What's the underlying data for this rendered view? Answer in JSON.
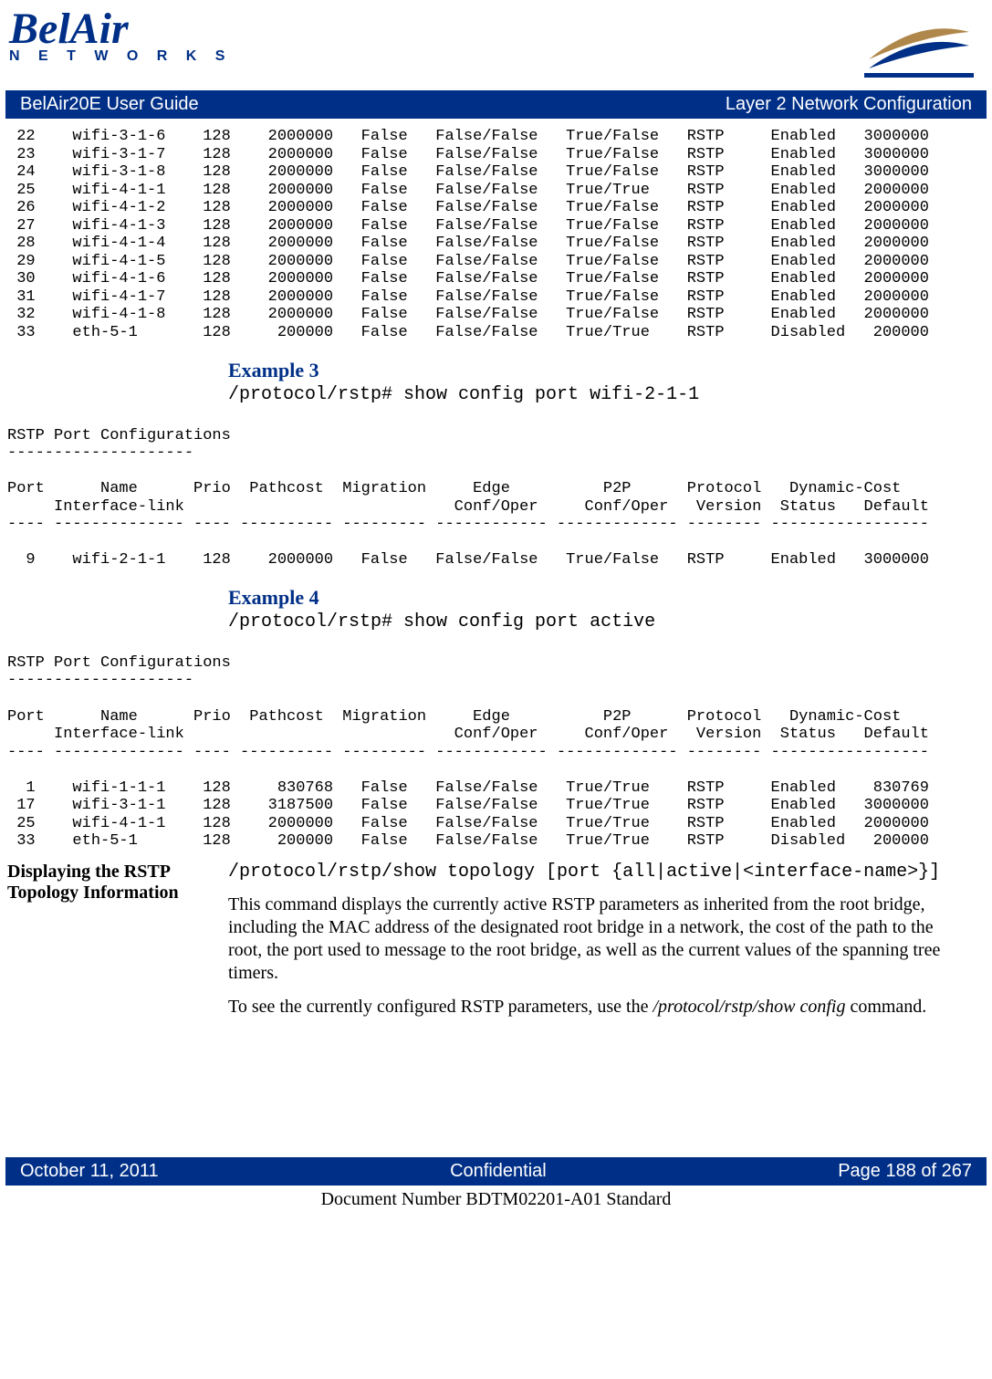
{
  "logo": {
    "brand": "BelAir",
    "sub": "N E T W O R K S"
  },
  "titlebar": {
    "left": "BelAir20E User Guide",
    "right": "Layer 2 Network Configuration"
  },
  "table1": " 22    wifi-3-1-6    128    2000000   False   False/False   True/False   RSTP     Enabled   3000000\n 23    wifi-3-1-7    128    2000000   False   False/False   True/False   RSTP     Enabled   3000000\n 24    wifi-3-1-8    128    2000000   False   False/False   True/False   RSTP     Enabled   3000000\n 25    wifi-4-1-1    128    2000000   False   False/False   True/True    RSTP     Enabled   2000000\n 26    wifi-4-1-2    128    2000000   False   False/False   True/False   RSTP     Enabled   2000000\n 27    wifi-4-1-3    128    2000000   False   False/False   True/False   RSTP     Enabled   2000000\n 28    wifi-4-1-4    128    2000000   False   False/False   True/False   RSTP     Enabled   2000000\n 29    wifi-4-1-5    128    2000000   False   False/False   True/False   RSTP     Enabled   2000000\n 30    wifi-4-1-6    128    2000000   False   False/False   True/False   RSTP     Enabled   2000000\n 31    wifi-4-1-7    128    2000000   False   False/False   True/False   RSTP     Enabled   2000000\n 32    wifi-4-1-8    128    2000000   False   False/False   True/False   RSTP     Enabled   2000000\n 33    eth-5-1       128     200000   False   False/False   True/True    RSTP     Disabled   200000",
  "ex3": {
    "heading": "Example 3",
    "cmd": "/protocol/rstp# show config port wifi-2-1-1"
  },
  "table2": "RSTP Port Configurations\n--------------------\n\nPort      Name      Prio  Pathcost  Migration     Edge          P2P      Protocol   Dynamic-Cost\n     Interface-link                             Conf/Oper     Conf/Oper   Version  Status   Default\n---- -------------- ---- ---------- --------- ------------ ------------- -------- -----------------\n\n  9    wifi-2-1-1    128    2000000   False   False/False   True/False   RSTP     Enabled   3000000",
  "ex4": {
    "heading": "Example 4",
    "cmd": "/protocol/rstp# show config port active"
  },
  "table3": "RSTP Port Configurations\n--------------------\n\nPort      Name      Prio  Pathcost  Migration     Edge          P2P      Protocol   Dynamic-Cost\n     Interface-link                             Conf/Oper     Conf/Oper   Version  Status   Default\n---- -------------- ---- ---------- --------- ------------ ------------- -------- -----------------\n\n  1    wifi-1-1-1    128     830768   False   False/False   True/True    RSTP     Enabled    830769\n 17    wifi-3-1-1    128    3187500   False   False/False   True/True    RSTP     Enabled   3000000\n 25    wifi-4-1-1    128    2000000   False   False/False   True/True    RSTP     Enabled   2000000\n 33    eth-5-1       128     200000   False   False/False   True/True    RSTP     Disabled   200000",
  "section": {
    "title": "Displaying the RSTP Topology Information",
    "syntax": "/protocol/rstp/show topology [port {all|active|<interface-name>}]",
    "para1": "This command displays the currently active RSTP parameters as inherited from the root bridge, including the MAC address of the designated root bridge in a network, the cost of the path to the root, the port used to message to the root bridge, as well as the current values of the spanning tree timers.",
    "para2a": "To see the currently configured RSTP parameters, use the ",
    "para2b": "/protocol/rstp/show config",
    "para2c": " command."
  },
  "footer": {
    "left": "October 11, 2011",
    "center": "Confidential",
    "right": "Page 188 of 267"
  },
  "docnum": "Document Number BDTM02201-A01 Standard"
}
